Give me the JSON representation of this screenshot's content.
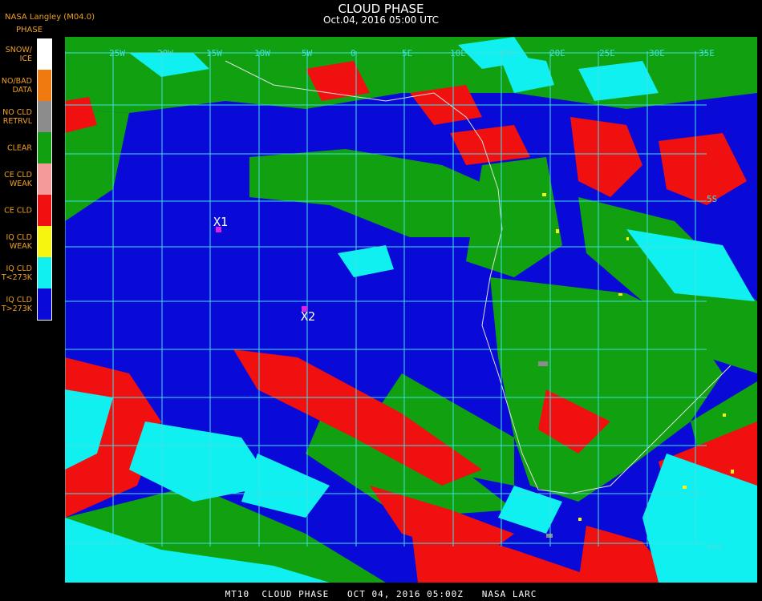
{
  "title": "CLOUD PHASE",
  "subtitle": "Oct.04, 2016 05:00 UTC",
  "brand": "NASA Langley (M04.0)",
  "legend_title": "PHASE",
  "legend": [
    {
      "label": "SNOW/\nICE",
      "color": "#ffffff"
    },
    {
      "label": "NO/BAD\nDATA",
      "color": "#f07a10"
    },
    {
      "label": "NO CLD\nRETRVL",
      "color": "#8c8c8c"
    },
    {
      "label": "CLEAR",
      "color": "#10a010"
    },
    {
      "label": "CE CLD\nWEAK",
      "color": "#f59a9a"
    },
    {
      "label": "CE CLD",
      "color": "#f01010"
    },
    {
      "label": "IQ CLD\nWEAK",
      "color": "#f5f510"
    },
    {
      "label": "IQ CLD\nT<273K",
      "color": "#10f0f0"
    },
    {
      "label": "IQ CLD\nT>273K",
      "color": "#0a0ad8"
    }
  ],
  "markers": [
    {
      "label": "X1"
    },
    {
      "label": "X2"
    }
  ],
  "lon_labels": [
    "25W",
    "20W",
    "15W",
    "10W",
    "5W",
    "0",
    "5E",
    "10E",
    "15E",
    "20E",
    "25E",
    "30E",
    "35E"
  ],
  "lat_labels": [
    "5S",
    "40S"
  ],
  "footer": "MT10  CLOUD PHASE   OCT 04, 2016 05:00Z   NASA LARC",
  "colors": {
    "ocean_liquid": "#0a0ad8",
    "clear": "#10a010",
    "ice": "#f01010",
    "supercooled": "#10f0f0",
    "grid": "#40e0e0",
    "marker": "#e020e0"
  }
}
